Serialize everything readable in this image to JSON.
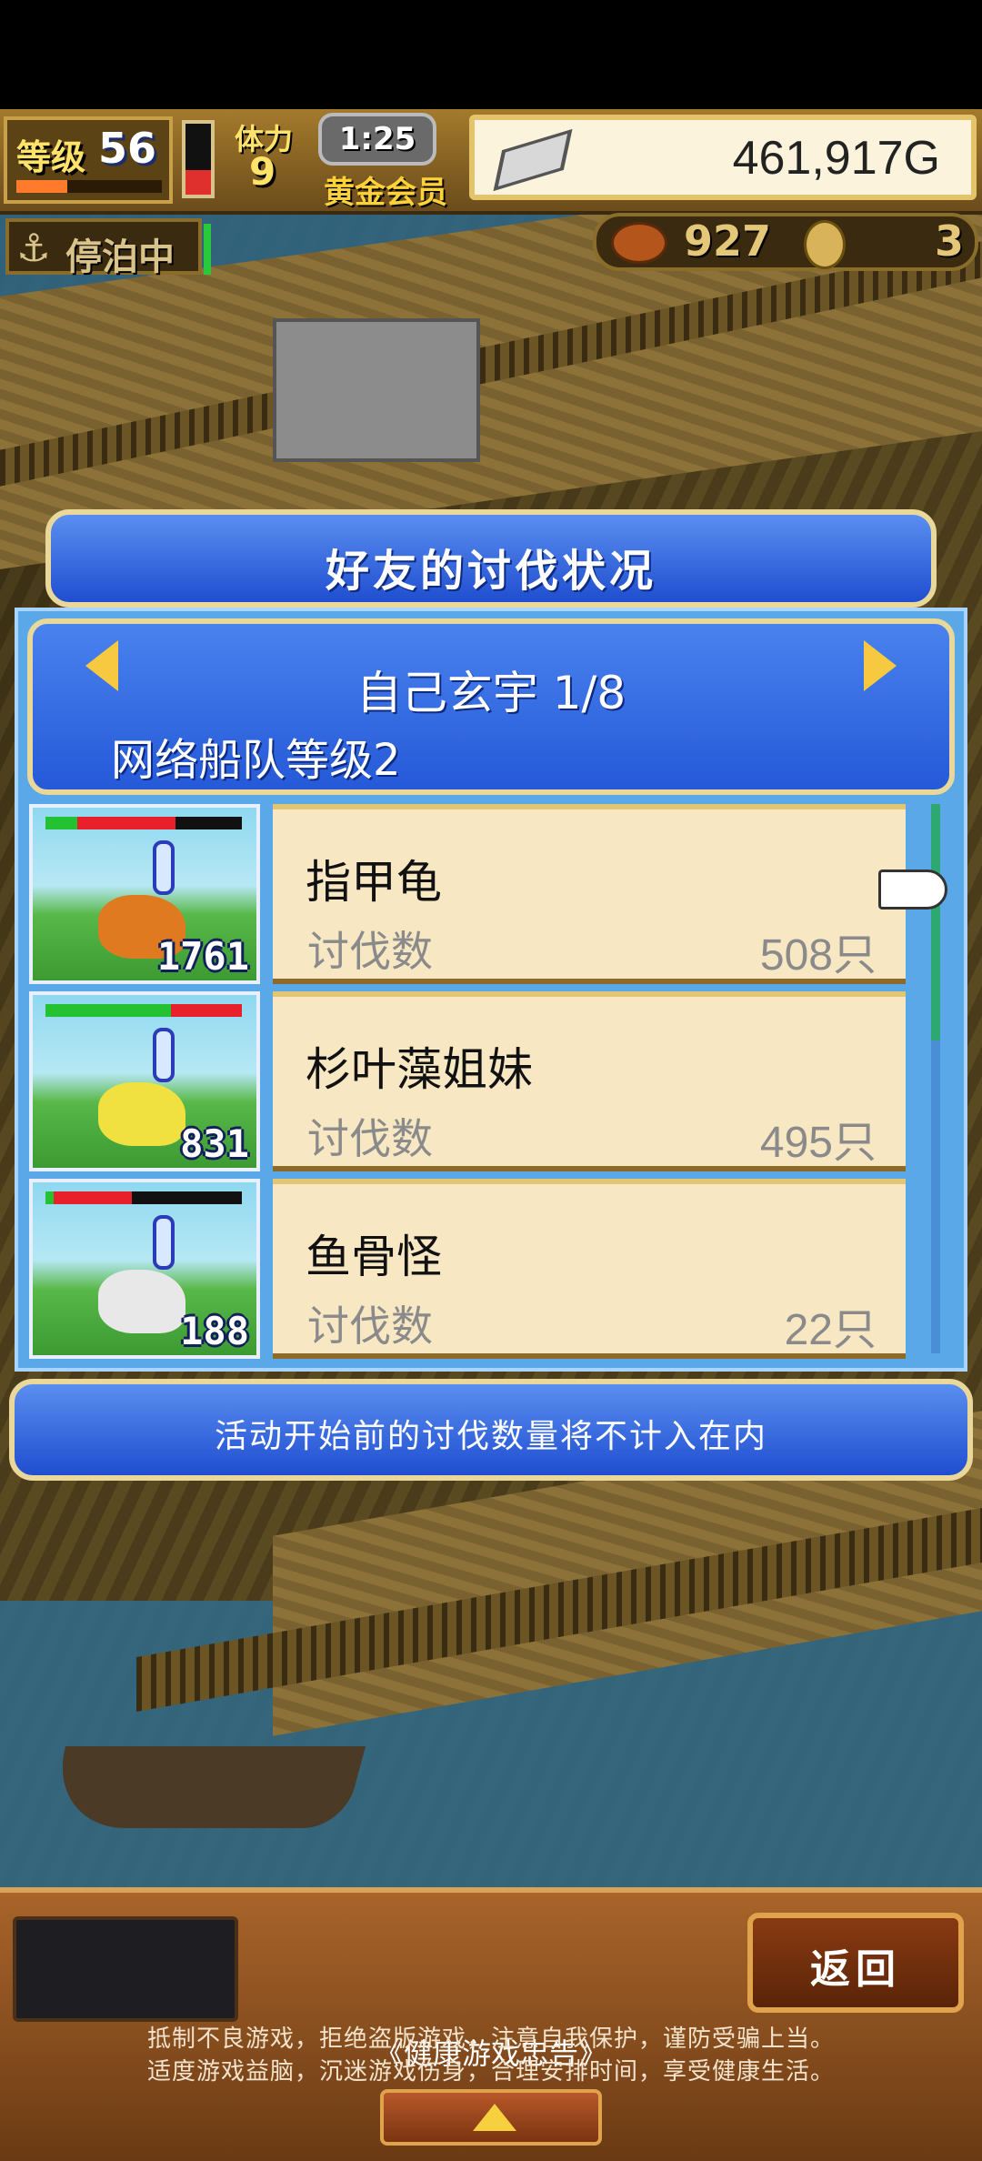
{
  "hud": {
    "level_label": "等级",
    "level_value": "56",
    "exp_fraction": 0.35,
    "hp_fraction": 0.35,
    "stamina_label": "体力",
    "stamina_value": "9",
    "clock": "1:25",
    "membership": "黄金会员",
    "gold": "461,917G",
    "anchor_status": "停泊中",
    "food_value": "927",
    "medal_value": "3"
  },
  "dialog": {
    "title": "好友的讨伐状况",
    "friend_name": "自己玄宇 1/8",
    "fleet_level": "网络船队等级2",
    "notice": "活动开始前的讨伐数量将不计入在内"
  },
  "monsters": [
    {
      "name": "指甲龟",
      "count_label": "讨伐数",
      "count_value": "508只",
      "badge": "1761",
      "hp_green": 0.16,
      "hp_red": 0.5,
      "color": "#e07a20"
    },
    {
      "name": "杉叶藻姐妹",
      "count_label": "讨伐数",
      "count_value": "495只",
      "badge": "831",
      "hp_green": 0.64,
      "hp_red": 0.36,
      "color": "#f0e040"
    },
    {
      "name": "鱼骨怪",
      "count_label": "讨伐数",
      "count_value": "22只",
      "badge": "188",
      "hp_green": 0.04,
      "hp_red": 0.4,
      "color": "#e8e8e8"
    }
  ],
  "footer": {
    "back_label": "返回",
    "health_title": "《健康游戏忠告》",
    "health_line1": "抵制不良游戏，拒绝盗版游戏，注意自我保护，谨防受骗上当。",
    "health_line2": "适度游戏益脑，沉迷游戏伤身，合理安排时间，享受健康生活。"
  }
}
